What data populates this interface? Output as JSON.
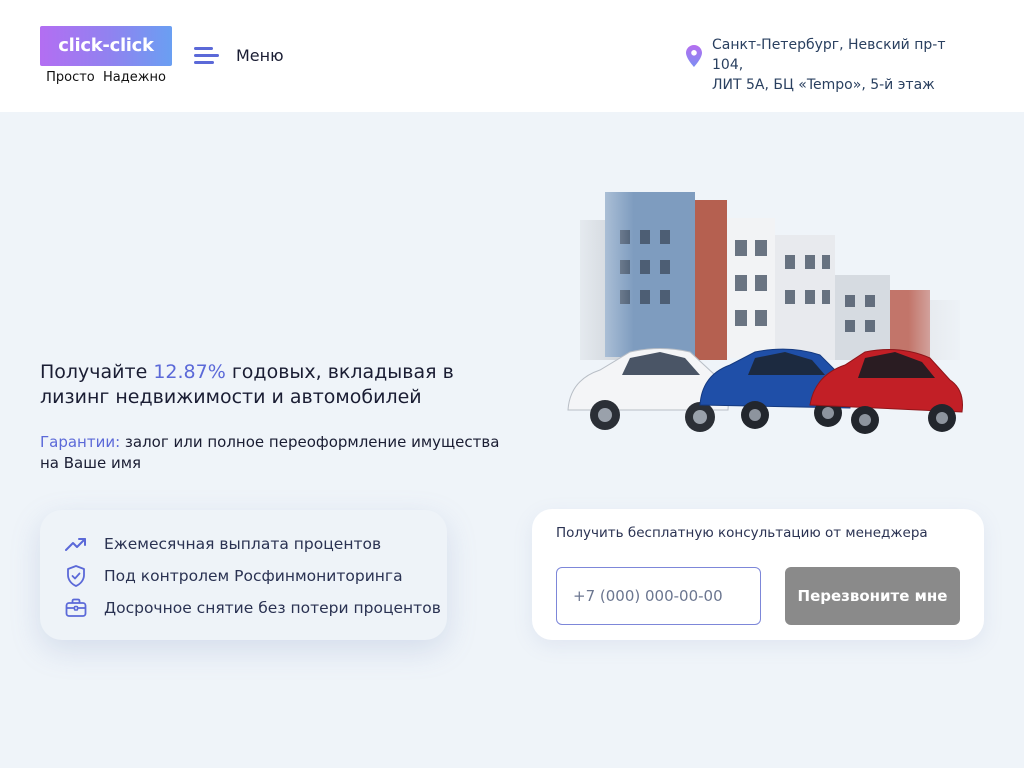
{
  "header": {
    "logo_text": "click-click",
    "logo_tagline": "Просто  Надежно",
    "menu_label": "Меню",
    "address_line1": "Санкт-Петербург, Невский пр-т 104,",
    "address_line2": "ЛИТ 5А, БЦ «Tempo», 5-й этаж"
  },
  "hero": {
    "headline_prefix": "Получайте ",
    "headline_rate": "12.87%",
    "headline_suffix": " годовых, вкладывая в лизинг недвижимости и автомобилей",
    "guarantee_label": "Гарантии:",
    "guarantee_text": " залог или полное переоформление имущества на Ваше имя"
  },
  "features": [
    {
      "icon": "trend-up-icon",
      "label": "Ежемесячная выплата процентов"
    },
    {
      "icon": "shield-check-icon",
      "label": "Под контролем Росфинмониторинга"
    },
    {
      "icon": "briefcase-icon",
      "label": "Досрочное снятие без потери процентов"
    }
  ],
  "consult": {
    "title": "Получить бесплатную консультацию от менеджера",
    "phone_placeholder": "+7 (000) 000-00-00",
    "phone_value": "",
    "button_label": "Перезвоните мне"
  },
  "colors": {
    "accent": "#5b69d8",
    "logo_gradient_start": "#b36ef2",
    "logo_gradient_end": "#6a9ff2",
    "page_background": "#eff4f9",
    "button_gray": "#8a8a8a"
  }
}
